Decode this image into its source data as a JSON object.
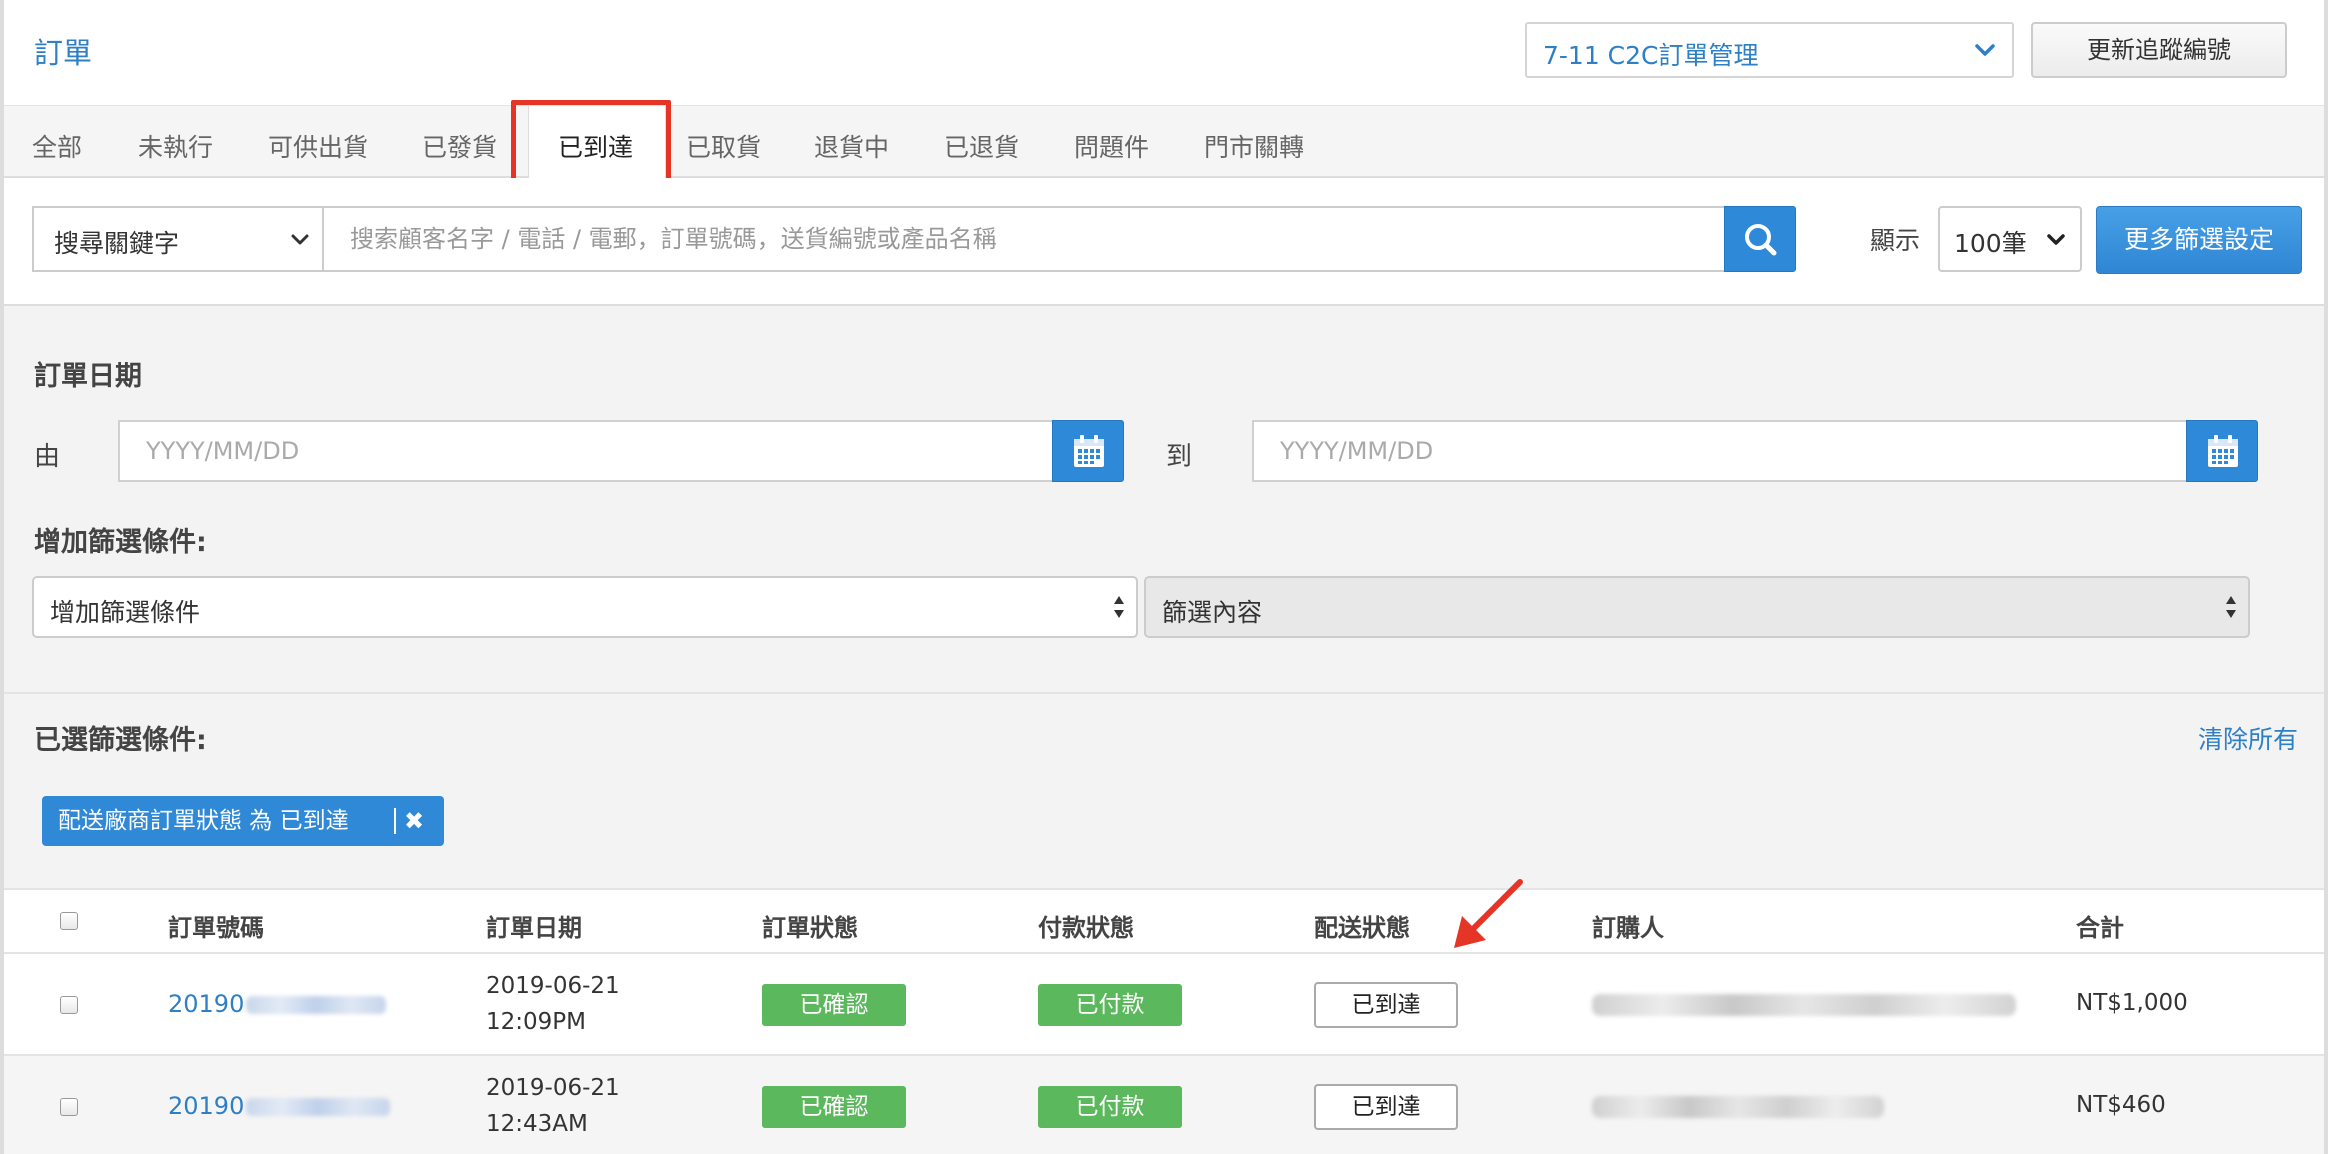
{
  "header": {
    "title": "訂單",
    "shop_select": "7-11 C2C訂單管理",
    "update_tracking_button": "更新追蹤編號"
  },
  "tabs": [
    {
      "label": "全部"
    },
    {
      "label": "未執行"
    },
    {
      "label": "可供出貨"
    },
    {
      "label": "已發貨"
    },
    {
      "label": "已到達",
      "active": true
    },
    {
      "label": "已取貨"
    },
    {
      "label": "退貨中"
    },
    {
      "label": "已退貨"
    },
    {
      "label": "問題件"
    },
    {
      "label": "門市關轉"
    }
  ],
  "search": {
    "keyword_select": "搜尋關鍵字",
    "placeholder": "搜索顧客名字 / 電話 / 電郵，訂單號碼，送貨編號或產品名稱",
    "show_label": "顯示",
    "page_size": "100筆",
    "more_filter_button": "更多篩選設定"
  },
  "filters": {
    "date_heading": "訂單日期",
    "from_label": "由",
    "to_label": "到",
    "date_placeholder": "YYYY/MM/DD",
    "add_condition_heading": "增加篩選條件:",
    "condition_select": "增加篩選條件",
    "content_select": "篩選內容",
    "selected_heading": "已選篩選條件:",
    "clear_all": "清除所有",
    "chip_label": "配送廠商訂單狀態 為 已到達",
    "chip_remove": "✖"
  },
  "table": {
    "columns": [
      "訂單號碼",
      "訂單日期",
      "訂單狀態",
      "付款狀態",
      "配送狀態",
      "訂購人",
      "合計"
    ],
    "rows": [
      {
        "order_prefix": "20190",
        "date": "2019-06-21",
        "time": "12:09PM",
        "order_status": "已確認",
        "payment_status": "已付款",
        "delivery_status": "已到達",
        "total": "NT$1,000"
      },
      {
        "order_prefix": "20190",
        "date": "2019-06-21",
        "time": "12:43AM",
        "order_status": "已確認",
        "payment_status": "已付款",
        "delivery_status": "已到達",
        "total": "NT$460"
      }
    ]
  },
  "colors": {
    "accent": "#2d7fc6",
    "button_blue": "#2e8ad8",
    "success": "#5cb85c",
    "highlight": "#e53527"
  }
}
